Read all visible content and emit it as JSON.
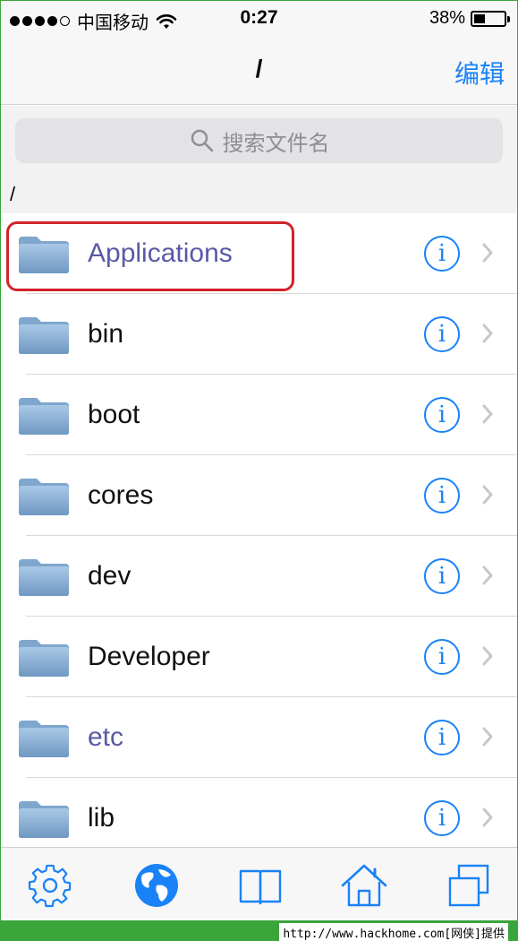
{
  "status_bar": {
    "carrier": "中国移动",
    "time": "0:27",
    "battery_percent": "38%",
    "battery_level": 0.38,
    "signal_bars": 4
  },
  "nav": {
    "title": "/",
    "edit_label": "编辑"
  },
  "search": {
    "placeholder": "搜索文件名"
  },
  "path": "/",
  "files": [
    {
      "name": "Applications",
      "highlighted": true
    },
    {
      "name": "bin"
    },
    {
      "name": "boot"
    },
    {
      "name": "cores"
    },
    {
      "name": "dev"
    },
    {
      "name": "Developer"
    },
    {
      "name": "etc"
    },
    {
      "name": "lib"
    }
  ],
  "tabs": [
    {
      "icon": "gear-icon"
    },
    {
      "icon": "globe-icon"
    },
    {
      "icon": "book-icon"
    },
    {
      "icon": "home-icon"
    },
    {
      "icon": "windows-icon"
    }
  ],
  "footer": {
    "text": "http://www.hackhome.com[网侠]提供"
  },
  "colors": {
    "accent": "#1a82f7",
    "highlight": "#d1232a",
    "footer": "#3aa53a"
  }
}
